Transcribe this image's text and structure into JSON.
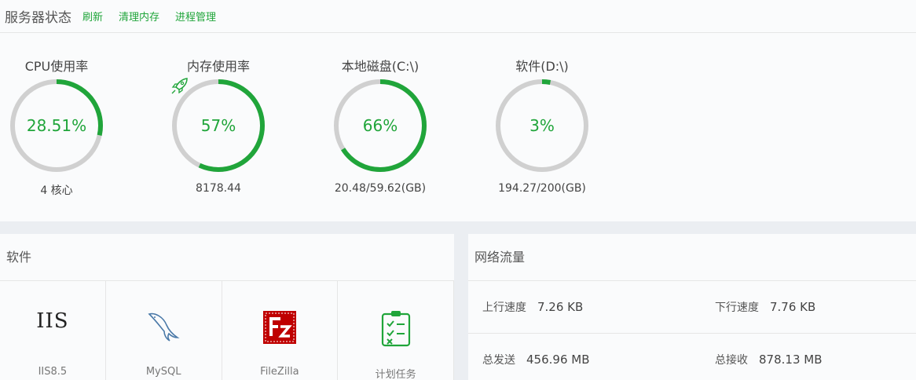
{
  "header": {
    "title": "服务器状态",
    "links": [
      "刷新",
      "清理内存",
      "进程管理"
    ]
  },
  "gauges": [
    {
      "label": "CPU使用率",
      "value": "28.51%",
      "percent": 28.51,
      "detail": "4 核心"
    },
    {
      "label": "内存使用率",
      "value": "57%",
      "percent": 57,
      "detail": "8178.44"
    },
    {
      "label": "本地磁盘(C:\\)",
      "value": "66%",
      "percent": 66,
      "detail": "20.48/59.62(GB)"
    },
    {
      "label": "软件(D:\\)",
      "value": "3%",
      "percent": 3,
      "detail": "194.27/200(GB)"
    }
  ],
  "colors": {
    "accent": "#20a53a",
    "track": "#d0d0d0"
  },
  "software": {
    "title": "软件",
    "items": [
      {
        "icon": "iis-icon",
        "text": "IIS",
        "name": "IIS8.5"
      },
      {
        "icon": "mysql-dolphin-icon",
        "name": "MySQL"
      },
      {
        "icon": "filezilla-icon",
        "name": "FileZilla"
      },
      {
        "icon": "task-list-icon",
        "name": "计划任务"
      }
    ]
  },
  "network": {
    "title": "网络流量",
    "up_label": "上行速度",
    "up_value": "7.26 KB",
    "down_label": "下行速度",
    "down_value": "7.76 KB",
    "sent_label": "总发送",
    "sent_value": "456.96 MB",
    "recv_label": "总接收",
    "recv_value": "878.13 MB"
  }
}
